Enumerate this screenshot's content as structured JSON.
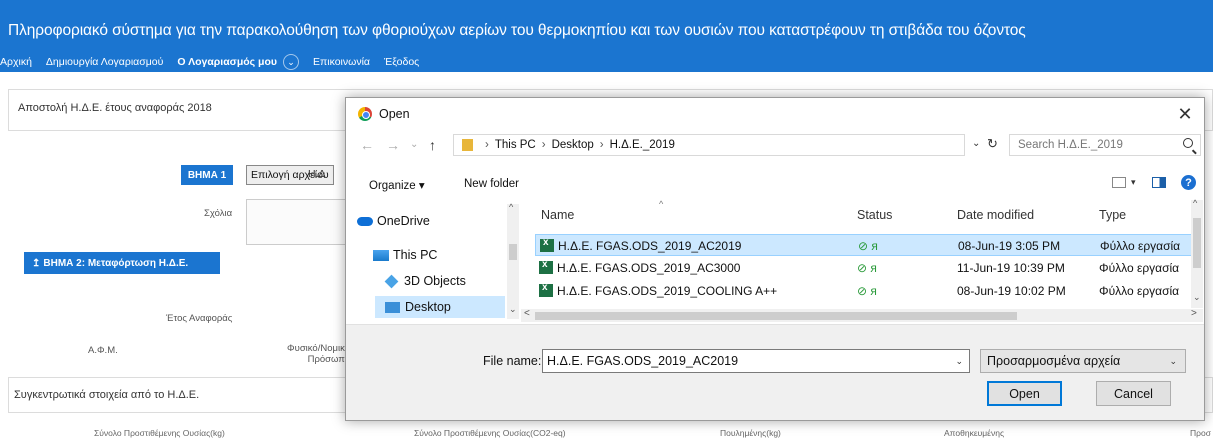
{
  "header": {
    "title": "Πληροφοριακό σύστημα για την παρακολούθηση των φθοριούχων αερίων του θερμοκηπίου και των ουσιών που καταστρέφουν τη στιβάδα του όζοντος",
    "nav": [
      "Αρχική",
      "Δημιουργία Λογαριασμού",
      "Ο Λογαριασμός μου",
      "Επικοινωνία",
      "Έξοδος"
    ],
    "nav_chevron": "⌄"
  },
  "background": {
    "panel_title": "Αποστολή Η.Δ.Ε. έτους αναφοράς 2018",
    "step1_label": "ΒΗΜΑ 1",
    "choose_file_label": "Επιλογή αρχείου",
    "choose_file_tail": "Η.Δ",
    "comments_label": "Σχόλια",
    "step2_label": "ΒΗΜΑ 2: Μεταφόρτωση Η.Δ.Ε.",
    "step2_icon": "↥",
    "year_label": "Έτος Αναφοράς",
    "afm_label": "Α.Φ.Μ.",
    "person_label_1": "Φυσικό/Νομικό",
    "person_label_2": "Πρόσωπο",
    "summary_title": "Συγκεντρωτικά στοιχεία από το Η.Δ.Ε.",
    "bottom_cols": [
      "Σύνολο Προστιθέμενης Ουσίας(kg)",
      "Σύνολο Προστιθέμενης Ουσίας(CO2-eq)",
      "Πουλημένης(kg)",
      "Αποθηκευμένης",
      "Προσ"
    ]
  },
  "dialog": {
    "title": "Open",
    "close_glyph": "✕",
    "back_glyph": "←",
    "forward_glyph": "→",
    "recent_glyph": "⌄",
    "up_glyph": "↑",
    "breadcrumb": [
      "This PC",
      "Desktop",
      "Η.Δ.Ε._2019"
    ],
    "crumb_sep": "›",
    "addr_dropdown": "⌄",
    "refresh_glyph": "↻",
    "search_placeholder": "Search Η.Δ.Ε._2019",
    "organize_label": "Organize ▾",
    "new_folder_label": "New folder",
    "help_glyph": "?",
    "view_dropdown": "▾",
    "nav_items": [
      "OneDrive",
      "This PC",
      "3D Objects",
      "Desktop"
    ],
    "columns": [
      "Name",
      "Status",
      "Date modified",
      "Type"
    ],
    "sort_caret": "^",
    "files": [
      {
        "name": "Η.Δ.Ε. FGAS.ODS_2019_AC2019",
        "status": "⊘ ᴙ",
        "date": "08-Jun-19 3:05 PM",
        "type": "Φύλλο εργασία"
      },
      {
        "name": "Η.Δ.Ε. FGAS.ODS_2019_AC3000",
        "status": "⊘ ᴙ",
        "date": "11-Jun-19 10:39 PM",
        "type": "Φύλλο εργασία"
      },
      {
        "name": "Η.Δ.Ε. FGAS.ODS_2019_COOLING A++",
        "status": "⊘ ᴙ",
        "date": "08-Jun-19 10:02 PM",
        "type": "Φύλλο εργασία"
      }
    ],
    "file_name_label": "File name:",
    "file_name_value": "Η.Δ.Ε. FGAS.ODS_2019_AC2019",
    "file_type_value": "Προσαρμοσμένα αρχεία",
    "open_label": "Open",
    "cancel_label": "Cancel",
    "scroll_left": "<",
    "scroll_right": ">",
    "scroll_up": "^",
    "scroll_down": "⌄"
  },
  "colors": {
    "brand_blue": "#1b75d0",
    "selection": "#cce8ff"
  }
}
